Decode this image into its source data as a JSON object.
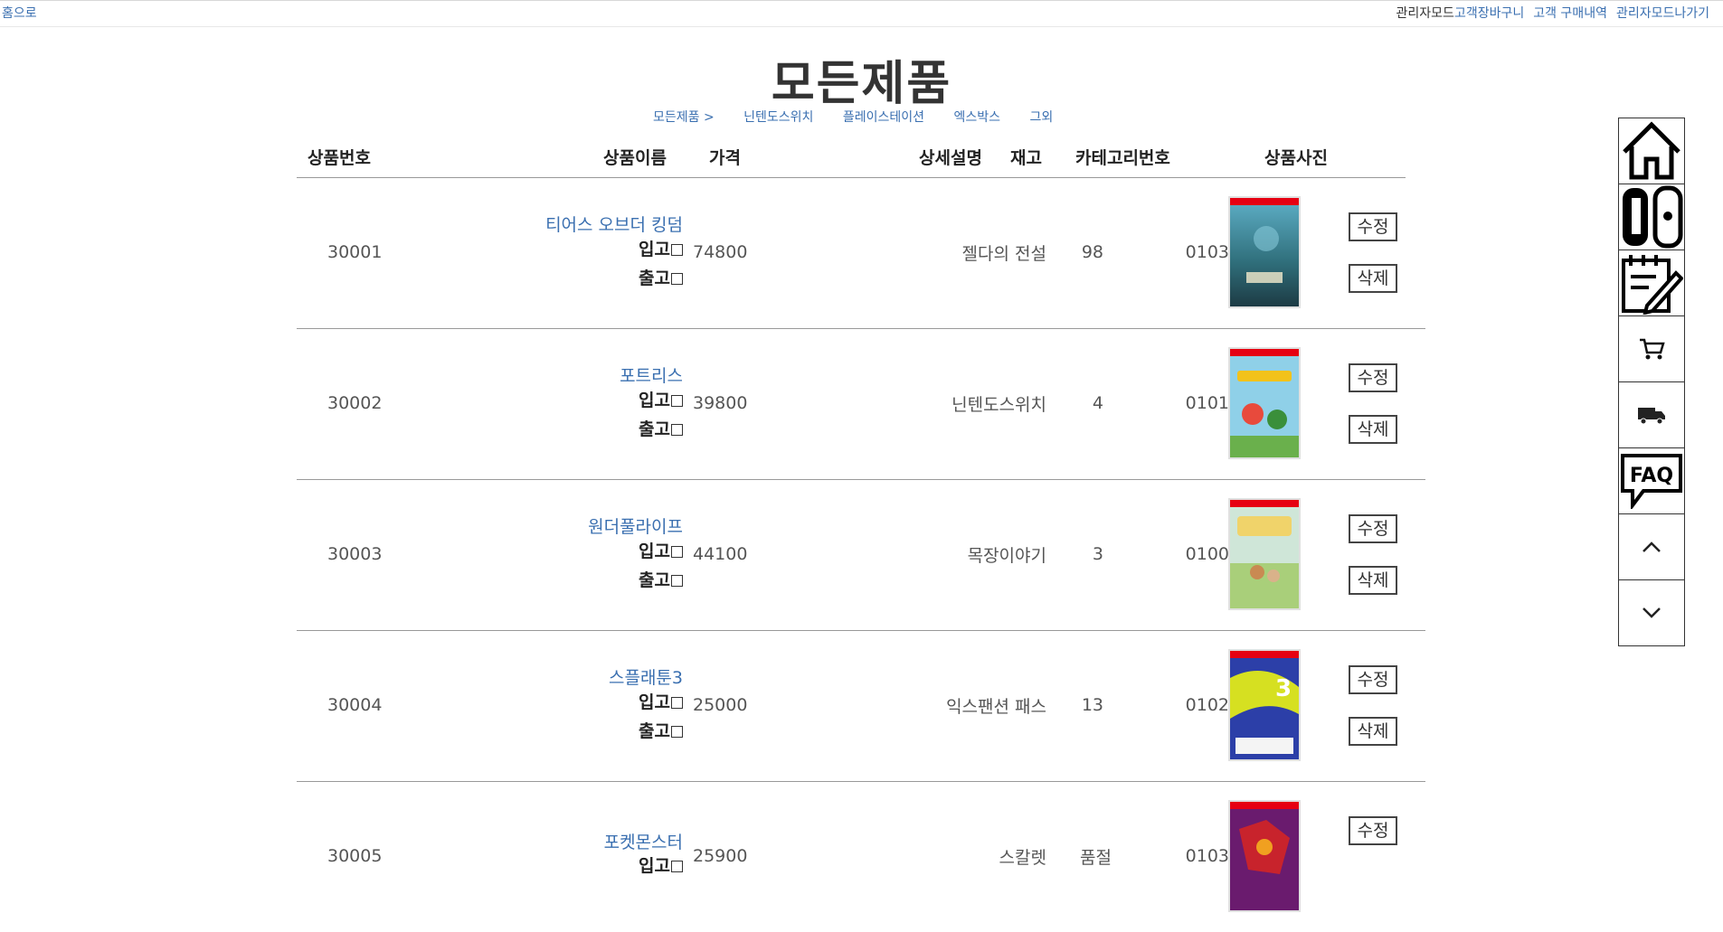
{
  "topbar": {
    "home": "홈으로",
    "admin_mode": "관리자모드",
    "links": [
      "고객장바구니",
      "고객 구매내역",
      "관리자모드나가기"
    ]
  },
  "title": "모든제품",
  "nav": {
    "current": "모든제품 >",
    "categories": [
      "닌텐도스위치",
      "플레이스테이션",
      "엑스박스",
      "그외"
    ]
  },
  "table": {
    "headers": [
      "상품번호",
      "상품이름",
      "가격",
      "상세설명",
      "재고",
      "카테고리번호",
      "상품사진"
    ],
    "in_label": "입고",
    "out_label": "출고",
    "edit_label": "수정",
    "delete_label": "삭제",
    "rows": [
      {
        "id": "30001",
        "name": "티어스 오브더 킹덤",
        "price": "74800",
        "desc": "젤다의 전설",
        "stock": "98",
        "category": "0103"
      },
      {
        "id": "30002",
        "name": "포트리스",
        "price": "39800",
        "desc": "닌텐도스위치",
        "stock": "4",
        "category": "0101"
      },
      {
        "id": "30003",
        "name": "원더풀라이프",
        "price": "44100",
        "desc": "목장이야기",
        "stock": "3",
        "category": "0100"
      },
      {
        "id": "30004",
        "name": "스플래툰3",
        "price": "25000",
        "desc": "익스팬션 패스",
        "stock": "13",
        "category": "0102"
      },
      {
        "id": "30005",
        "name": "포켓몬스터",
        "price": "25900",
        "desc": "스칼렛",
        "stock": "품절",
        "category": "0103"
      }
    ]
  },
  "sidebar": {
    "icons": [
      "home-icon",
      "switch-console-icon",
      "edit-note-icon",
      "cart-icon",
      "delivery-truck-icon",
      "faq-icon",
      "scroll-up-icon",
      "scroll-down-icon"
    ],
    "faq_text": "FAQ"
  },
  "colors": {
    "link": "#3a6fb0",
    "border": "#999999"
  }
}
